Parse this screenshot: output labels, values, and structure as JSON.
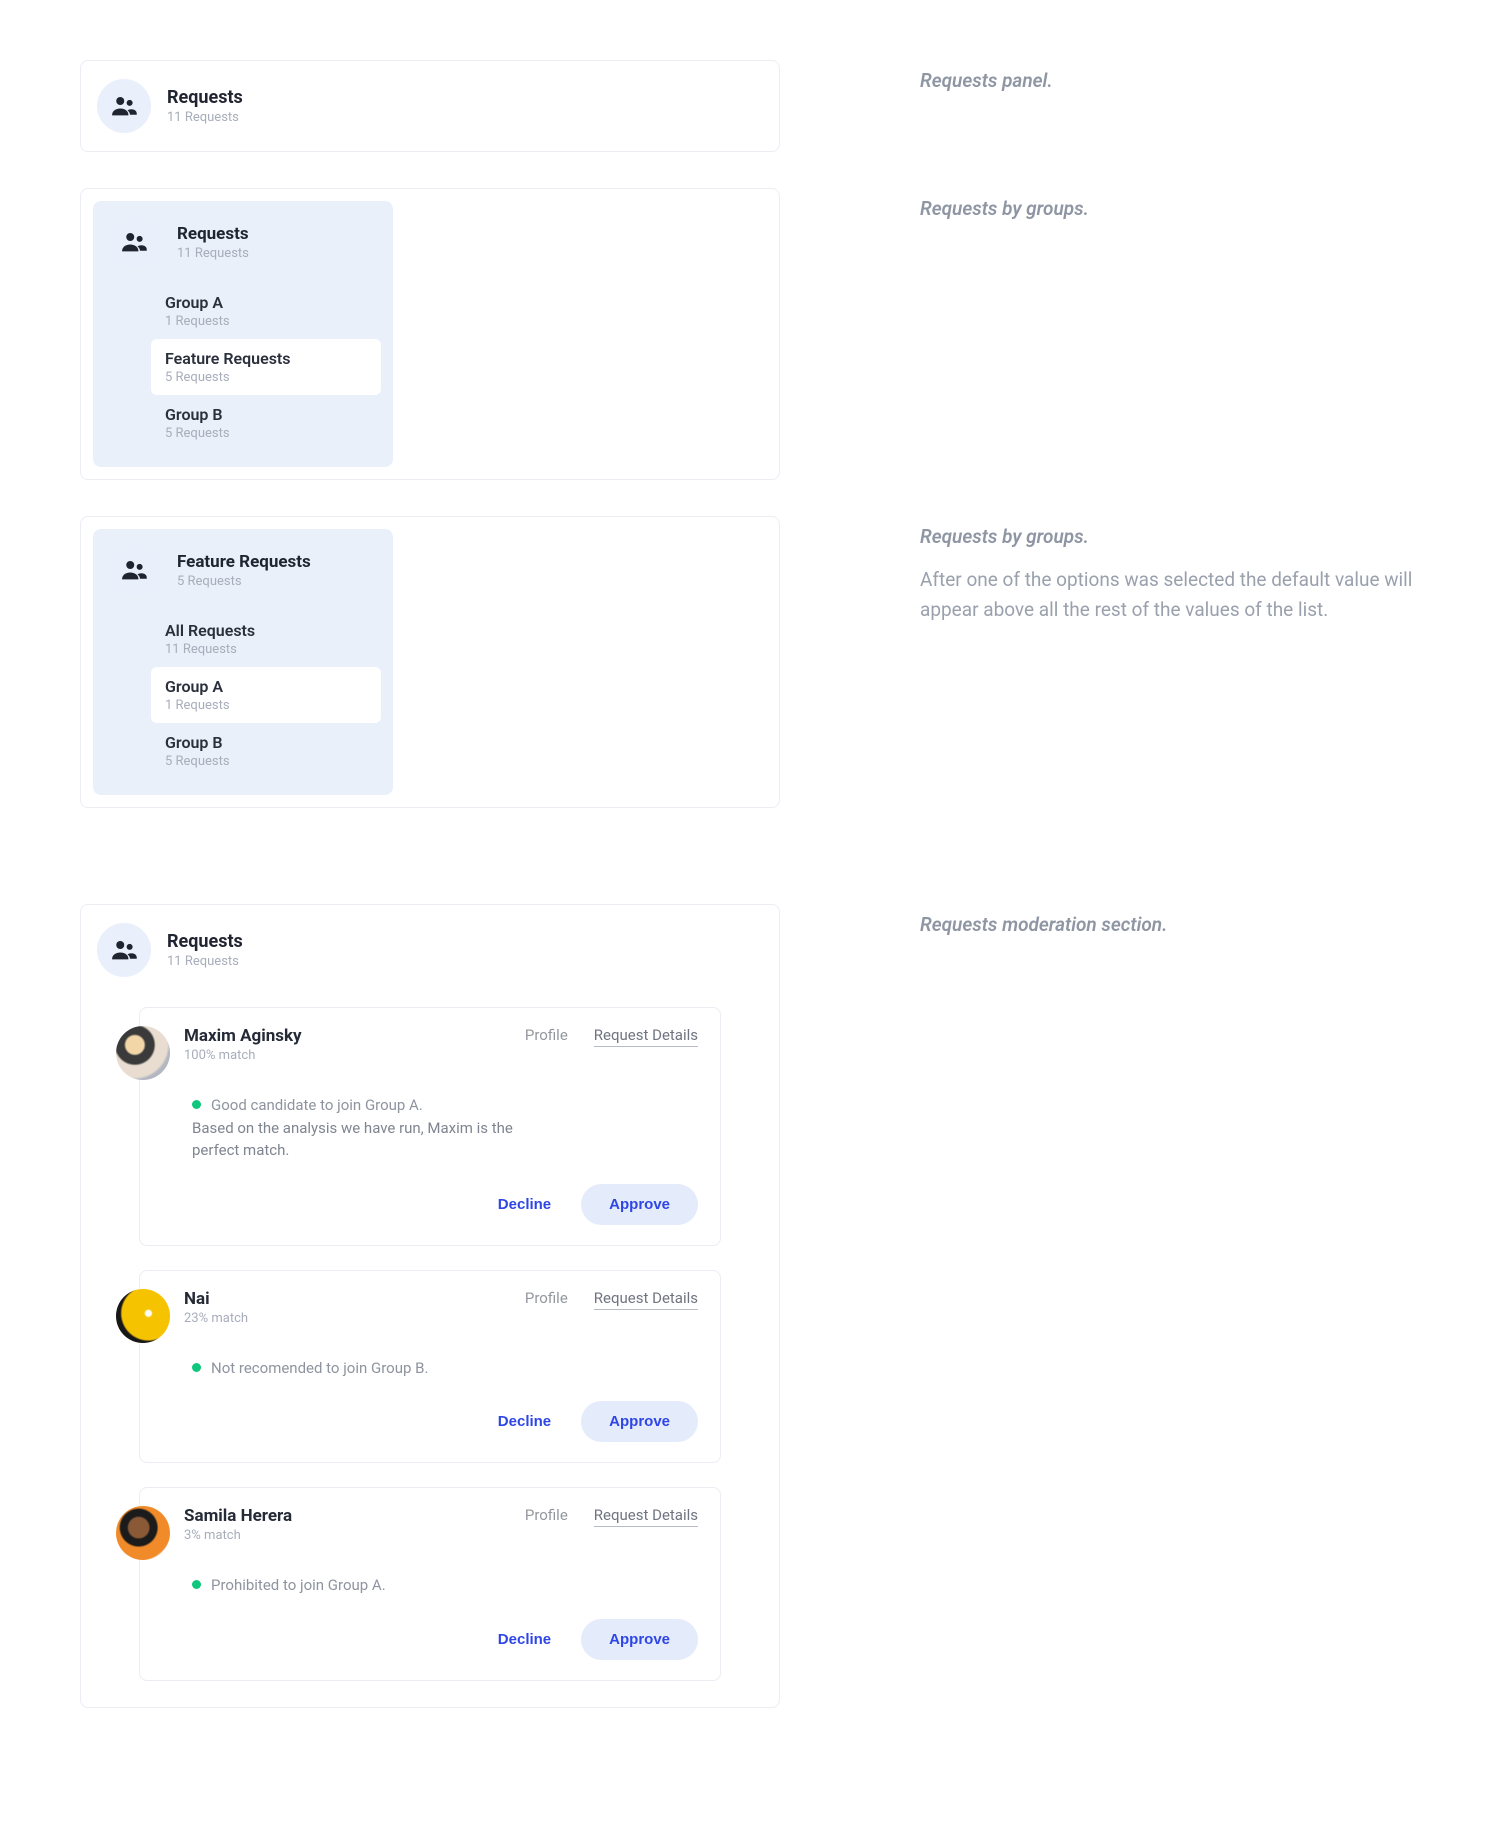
{
  "captions": {
    "s1": {
      "title": "Requests panel."
    },
    "s2": {
      "title": "Requests by groups."
    },
    "s3": {
      "title": "Requests by groups.",
      "body": "After one of the options was selected the default value will appear above all the rest of the values of the list."
    },
    "s4": {
      "title": "Requests moderation section."
    }
  },
  "section1": {
    "title": "Requests",
    "subtitle": "11 Requests"
  },
  "section2": {
    "title": "Requests",
    "subtitle": "11 Requests",
    "items": [
      {
        "title": "Group A",
        "sub": "1 Requests",
        "selected": false
      },
      {
        "title": "Feature Requests",
        "sub": "5 Requests",
        "selected": true
      },
      {
        "title": "Group B",
        "sub": "5 Requests",
        "selected": false
      }
    ]
  },
  "section3": {
    "title": "Feature Requests",
    "subtitle": "5 Requests",
    "items": [
      {
        "title": "All Requests",
        "sub": "11 Requests",
        "selected": false
      },
      {
        "title": "Group A",
        "sub": "1 Requests",
        "selected": true
      },
      {
        "title": "Group B",
        "sub": "5 Requests",
        "selected": false
      }
    ]
  },
  "section4": {
    "title": "Requests",
    "subtitle": "11 Requests",
    "links": {
      "profile": "Profile",
      "details": "Request Details"
    },
    "actions": {
      "decline": "Decline",
      "approve": "Approve"
    },
    "cards": [
      {
        "name": "Maxim Aginsky",
        "match": "100% match",
        "headline": "Good candidate to join Group A.",
        "extra": "Based on the analysis we have run, Maxim is the perfect match."
      },
      {
        "name": "Nai",
        "match": "23% match",
        "headline": "Not recomended to join Group B.",
        "extra": ""
      },
      {
        "name": "Samila Herera",
        "match": "3% match",
        "headline": "Prohibited to join Group A.",
        "extra": ""
      }
    ]
  }
}
